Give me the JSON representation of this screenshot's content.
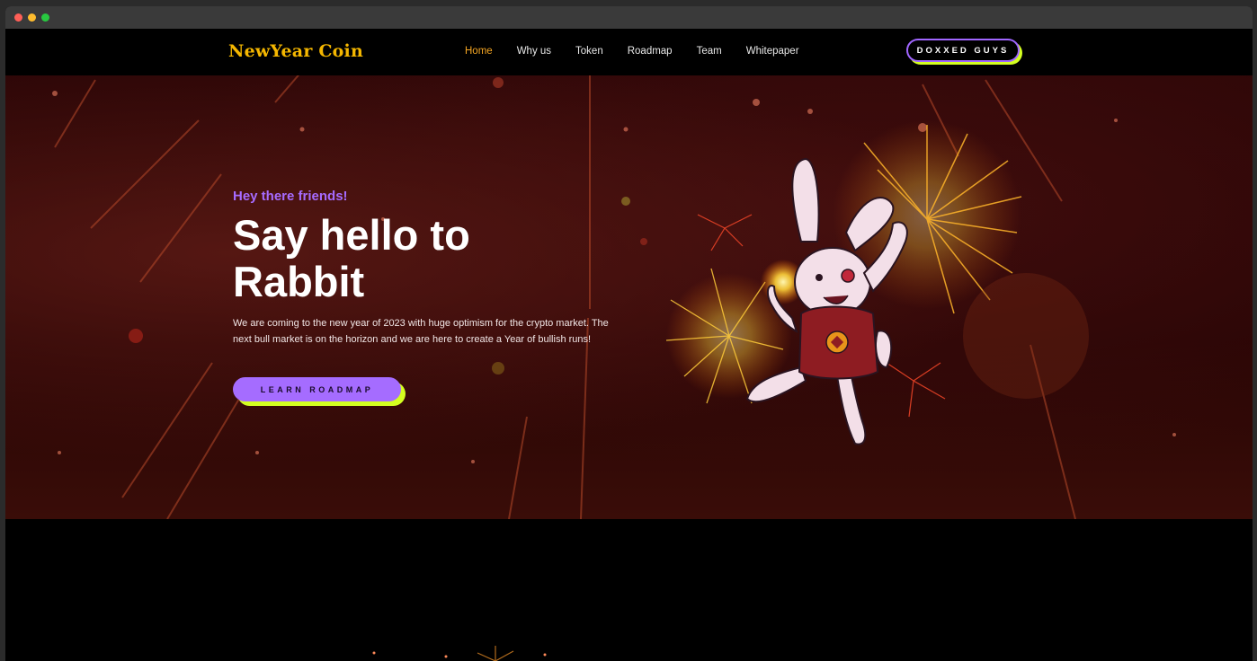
{
  "window": {
    "controls": [
      "close",
      "minimize",
      "maximize"
    ]
  },
  "nav": {
    "logo": "NewYear Coin",
    "links": [
      "Home",
      "Why us",
      "Token",
      "Roadmap",
      "Team",
      "Whitepaper"
    ],
    "active": "Home",
    "cta": "DOXXED GUYS"
  },
  "hero": {
    "eyebrow": "Hey there friends!",
    "headline": "Say hello to Rabbit",
    "description": "We are coming to the new year of 2023 with huge optimism for the crypto market. The next bull market is on the horizon and we are here to create a Year of bullish runs!",
    "button": "LEARN ROADMAP",
    "mascot": "rabbit-mascot-with-fireworks"
  },
  "colors": {
    "logo": "#f5b700",
    "active_link": "#f5a623",
    "accent_purple": "#a56cff",
    "accent_lime": "#d4ff20",
    "hero_bg": "#2a0506"
  }
}
